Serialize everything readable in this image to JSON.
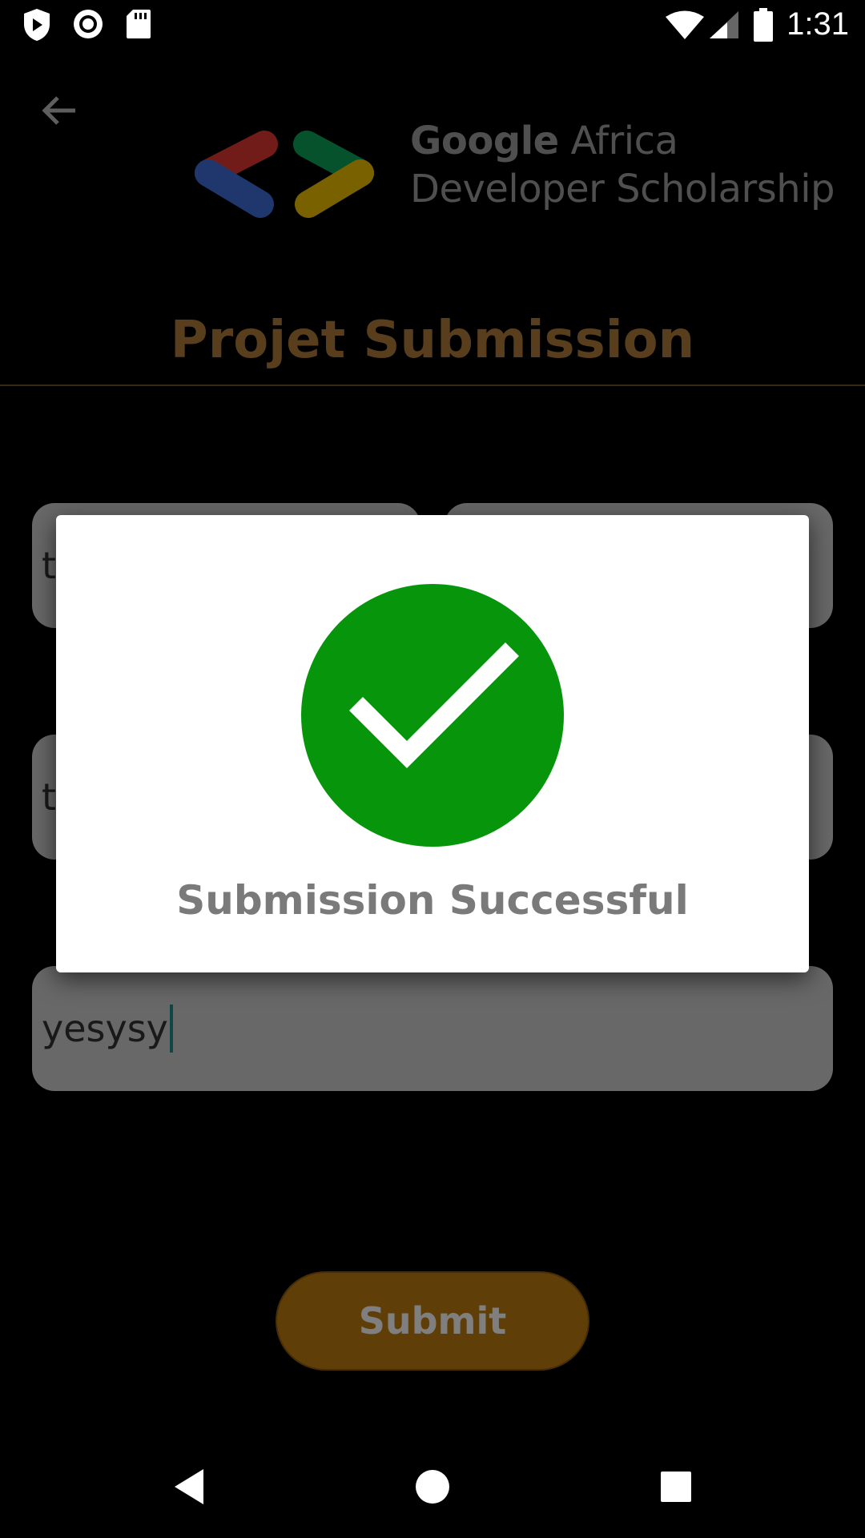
{
  "status_bar": {
    "time": "1:31",
    "left_icons": [
      "play-protect-icon",
      "record-icon",
      "sd-card-icon"
    ],
    "right_icons": [
      "wifi-icon",
      "signal-icon",
      "battery-icon"
    ]
  },
  "header": {
    "back_icon": "arrow-left-icon",
    "logo_brand": "Google",
    "logo_line1_rest": "Africa",
    "logo_line2": "Developer Scholarship",
    "page_title": "Projet Submission"
  },
  "form": {
    "first_name_value": "te",
    "last_name_value": "",
    "email_value": "te",
    "github_link_value": "yesysy",
    "submit_label": "Submit"
  },
  "dialog": {
    "icon": "check-circle-icon",
    "message": "Submission Successful"
  },
  "nav_bar": {
    "icons": [
      "back-triangle-icon",
      "home-circle-icon",
      "recents-square-icon"
    ]
  },
  "colors": {
    "title": "#b07d3a",
    "submit_button": "#c17d10",
    "success_green": "#07960b",
    "dialog_text": "#7a7a7a"
  }
}
